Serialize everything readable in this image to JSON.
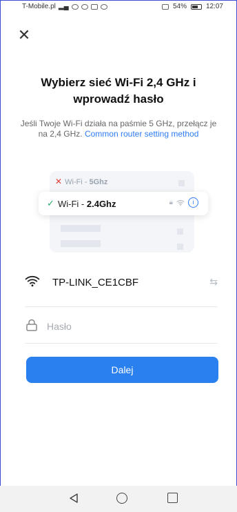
{
  "status_bar": {
    "carrier": "T-Mobile.pl",
    "battery": "54%",
    "time": "12:07"
  },
  "title": "Wybierz sieć Wi-Fi 2,4 GHz i wprowadź hasło",
  "subtitle": {
    "text": "Jeśli Twoje Wi-Fi działa na paśmie 5 GHz, przełącz je na 2,4 GHz.",
    "link": "Common router setting method"
  },
  "illustration": {
    "bad_network_prefix": "Wi-Fi - ",
    "bad_network_band": "5Ghz",
    "good_network_prefix": "Wi-Fi - ",
    "good_network_band": "2.4Ghz"
  },
  "wifi": {
    "ssid": "TP-LINK_CE1CBF"
  },
  "password": {
    "placeholder": "Hasło",
    "value": ""
  },
  "next_button": "Dalej",
  "colors": {
    "accent": "#2b80f0",
    "link": "#2e7cf6",
    "ok": "#2aa86a",
    "error": "#e03a3a"
  }
}
